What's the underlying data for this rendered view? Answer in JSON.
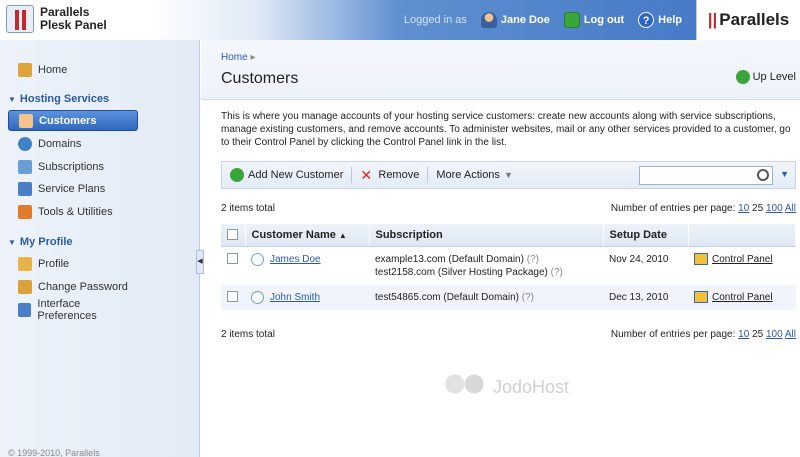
{
  "header": {
    "logo_line1": "Parallels",
    "logo_line2": "Plesk Panel",
    "logged_in_as": "Logged in as",
    "user_name": "Jane Doe",
    "logout": "Log out",
    "help": "Help",
    "brand": "Parallels",
    "brand_bars": "||"
  },
  "sidebar": {
    "home": "Home",
    "section_hosting": "Hosting Services",
    "items": [
      "Customers",
      "Domains",
      "Subscriptions",
      "Service Plans",
      "Tools & Utilities"
    ],
    "section_profile": "My Profile",
    "profile_items": [
      "Profile",
      "Change Password",
      "Interface Preferences"
    ],
    "copyright": "© 1999-2010, Parallels"
  },
  "main": {
    "breadcrumb": "Home",
    "title": "Customers",
    "up_level": "Up Level",
    "intro": "This is where you manage accounts of your hosting service customers: create new accounts along with service subscriptions, manage existing customers, and remove accounts. To administer websites, mail or any other services provided to a customer, go to their Control Panel by clicking the Control Panel link in the list.",
    "toolbar": {
      "add": "Add New Customer",
      "remove": "Remove",
      "more": "More Actions"
    },
    "search_placeholder": "",
    "total": "2 items total",
    "per_page_label": "Number of entries per page:",
    "per_page_options": [
      "10",
      "25",
      "100",
      "All"
    ],
    "columns": [
      "Customer Name",
      "Subscription",
      "Setup Date",
      ""
    ],
    "rows": [
      {
        "name": "James Doe",
        "sub1": "example13.com (Default Domain)",
        "sub2": "test2158.com (Silver Hosting Package)",
        "date": "Nov 24, 2010",
        "action": "Control Panel"
      },
      {
        "name": "John Smith",
        "sub1": "test54865.com (Default Domain)",
        "sub2": "",
        "date": "Dec 13, 2010",
        "action": "Control Panel"
      }
    ],
    "help_mark": "(?)"
  },
  "watermark": "JodoHost"
}
